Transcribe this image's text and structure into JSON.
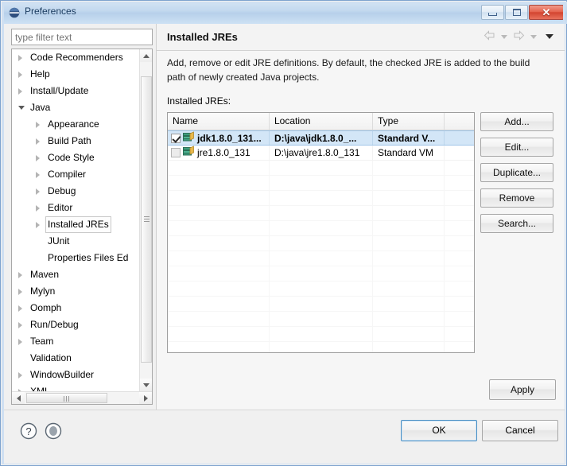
{
  "window": {
    "title": "Preferences",
    "icon": "eclipse-logo-icon",
    "controls": {
      "minimize": "minimize-button",
      "maximize": "maximize-button",
      "close": "close-button",
      "close_glyph": "✕"
    }
  },
  "filter": {
    "placeholder": "type filter text",
    "value": ""
  },
  "tree": {
    "items": [
      {
        "label": "Code Recommenders",
        "indent": 0,
        "state": "collapsed",
        "selected": false
      },
      {
        "label": "Help",
        "indent": 0,
        "state": "collapsed",
        "selected": false
      },
      {
        "label": "Install/Update",
        "indent": 0,
        "state": "collapsed",
        "selected": false
      },
      {
        "label": "Java",
        "indent": 0,
        "state": "expanded",
        "selected": false
      },
      {
        "label": "Appearance",
        "indent": 1,
        "state": "collapsed",
        "selected": false
      },
      {
        "label": "Build Path",
        "indent": 1,
        "state": "collapsed",
        "selected": false
      },
      {
        "label": "Code Style",
        "indent": 1,
        "state": "collapsed",
        "selected": false
      },
      {
        "label": "Compiler",
        "indent": 1,
        "state": "collapsed",
        "selected": false
      },
      {
        "label": "Debug",
        "indent": 1,
        "state": "collapsed",
        "selected": false
      },
      {
        "label": "Editor",
        "indent": 1,
        "state": "collapsed",
        "selected": false
      },
      {
        "label": "Installed JREs",
        "indent": 1,
        "state": "collapsed",
        "selected": true
      },
      {
        "label": "JUnit",
        "indent": 1,
        "state": "leaf",
        "selected": false
      },
      {
        "label": "Properties Files Ed",
        "indent": 1,
        "state": "leaf",
        "selected": false
      },
      {
        "label": "Maven",
        "indent": 0,
        "state": "collapsed",
        "selected": false
      },
      {
        "label": "Mylyn",
        "indent": 0,
        "state": "collapsed",
        "selected": false
      },
      {
        "label": "Oomph",
        "indent": 0,
        "state": "collapsed",
        "selected": false
      },
      {
        "label": "Run/Debug",
        "indent": 0,
        "state": "collapsed",
        "selected": false
      },
      {
        "label": "Team",
        "indent": 0,
        "state": "collapsed",
        "selected": false
      },
      {
        "label": "Validation",
        "indent": 0,
        "state": "leaf",
        "selected": false
      },
      {
        "label": "WindowBuilder",
        "indent": 0,
        "state": "collapsed",
        "selected": false
      },
      {
        "label": "XML",
        "indent": 0,
        "state": "collapsed",
        "selected": false
      }
    ]
  },
  "content": {
    "title": "Installed JREs",
    "nav": {
      "back": "back-arrow-icon",
      "forward": "forward-arrow-icon",
      "menu": "view-menu-caret-icon"
    },
    "description": "Add, remove or edit JRE definitions. By default, the checked JRE is added to the build path of newly created Java projects.",
    "table_label": "Installed JREs:",
    "table": {
      "columns": [
        "Name",
        "Location",
        "Type",
        ""
      ],
      "rows": [
        {
          "checked": true,
          "selected": true,
          "icon": "jre-icon",
          "name": "jdk1.8.0_131...",
          "location": "D:\\java\\jdk1.8.0_...",
          "type": "Standard V...",
          "pad": ""
        },
        {
          "checked": false,
          "selected": false,
          "icon": "jre-icon",
          "name": "jre1.8.0_131",
          "location": "D:\\java\\jre1.8.0_131",
          "type": "Standard VM",
          "pad": ""
        }
      ],
      "empty_row_count": 13
    },
    "buttons": [
      {
        "label": "Add...",
        "name": "add-button"
      },
      {
        "label": "Edit...",
        "name": "edit-button"
      },
      {
        "label": "Duplicate...",
        "name": "duplicate-button"
      },
      {
        "label": "Remove",
        "name": "remove-button"
      },
      {
        "label": "Search...",
        "name": "search-button"
      }
    ],
    "apply_label": "Apply"
  },
  "footer": {
    "help_icon": "help-question-icon",
    "record_icon": "oomph-record-icon",
    "ok_label": "OK",
    "cancel_label": "Cancel"
  },
  "colors": {
    "title_bar": "#c3d9ef",
    "frame_border": "#7da2ce",
    "selection": "#d3e6f7",
    "selection_border": "#9fc5e8",
    "focus_ring": "#4a90c4",
    "close_button": "#d2432f"
  }
}
